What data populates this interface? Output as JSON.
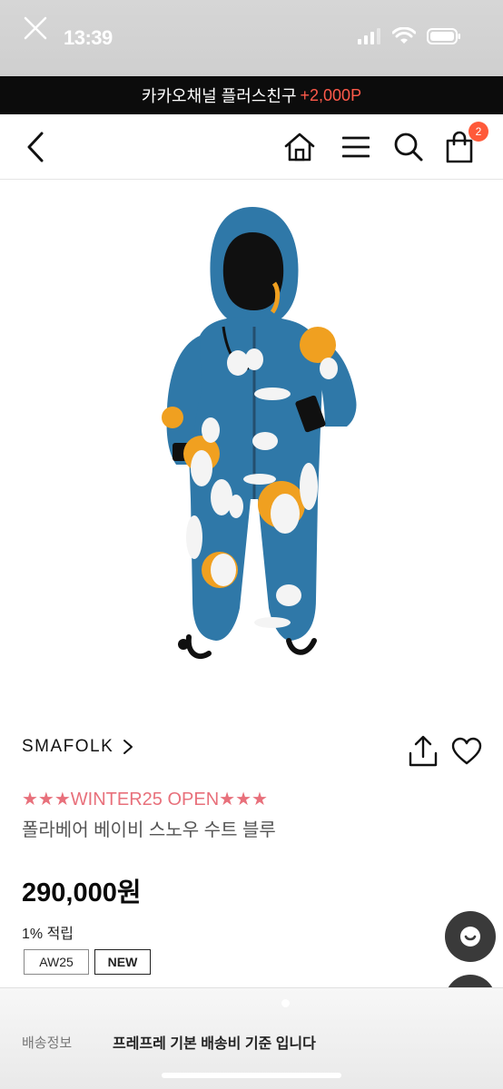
{
  "status_bar": {
    "time": "13:39"
  },
  "promo_banner": {
    "text": "카카오채널 플러스친구",
    "accent": "+2,000P"
  },
  "header": {
    "cart_count": "2"
  },
  "product": {
    "brand": "SMAFOLK",
    "promo_title": "★★★WINTER25 OPEN★★★",
    "name": "폴라베어 베이비 스노우 수트 블루",
    "price": "290,000원",
    "points": "1% 적립",
    "tags": [
      "AW25",
      "NEW"
    ]
  },
  "bottom_sheet": {
    "label": "배송정보",
    "text": "프레프레 기본 배송비 기준 입니다"
  },
  "colors": {
    "accent_red": "#ff5a4a",
    "promo_pink": "#e8707b",
    "suit_blue": "#2f78a8",
    "cart_badge": "#ff5a3a",
    "fab_dark": "#3a3a3a"
  },
  "icons": {
    "close": "close-icon",
    "back": "chevron-left-icon",
    "home": "home-icon",
    "menu": "hamburger-menu-icon",
    "search": "search-icon",
    "cart": "shopping-bag-icon",
    "share": "share-icon",
    "wishlist": "heart-icon",
    "chat": "chat-icon",
    "scroll_top": "chevron-up-icon"
  }
}
